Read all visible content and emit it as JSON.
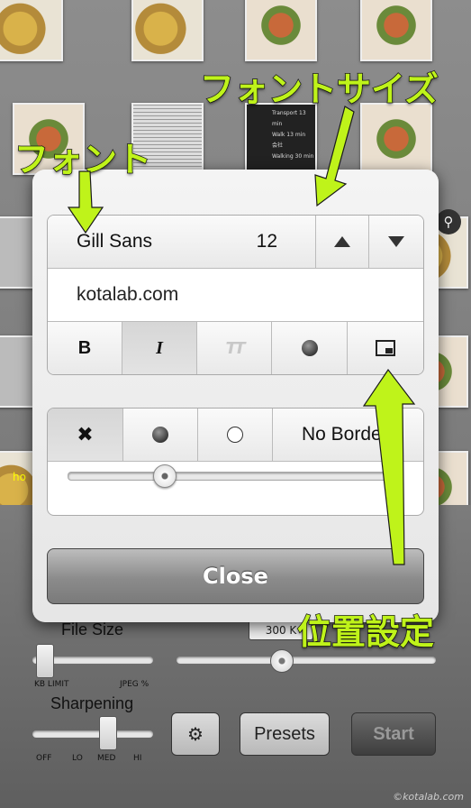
{
  "background": {
    "bottom_bar": {
      "file_size_label": "File Size",
      "kb_limit_label": "KB LIMIT",
      "jpeg_label": "JPEG %",
      "tooltip_value": "300 K",
      "sharpening_label": "Sharpening",
      "sharpening_ticks": [
        "OFF",
        "LO",
        "MED",
        "HI"
      ],
      "presets_label": "Presets",
      "start_label": "Start",
      "watermark": "©kotalab.com"
    },
    "thumbnail_texts": {
      "transit_line1": "Transport 13 min",
      "transit_line2": "Walk 13 min",
      "transit_line3": "会社",
      "transit_line4": "Walking 30 min"
    },
    "partial_label": "ho"
  },
  "dialog": {
    "font": {
      "name": "Gill Sans",
      "size": "12"
    },
    "text_value": "kotalab.com",
    "style_buttons": {
      "bold": "B",
      "italic": "I",
      "caps": "TT"
    },
    "border_row": {
      "no_border_label": "No Borde"
    },
    "slider_value": 0.22,
    "close_label": "Close"
  },
  "annotations": {
    "font": "フォント",
    "font_size": "フォントサイズ",
    "position": "位置設定"
  },
  "colors": {
    "annotation": "#bff31a",
    "close_button": "#8b8b8b"
  }
}
